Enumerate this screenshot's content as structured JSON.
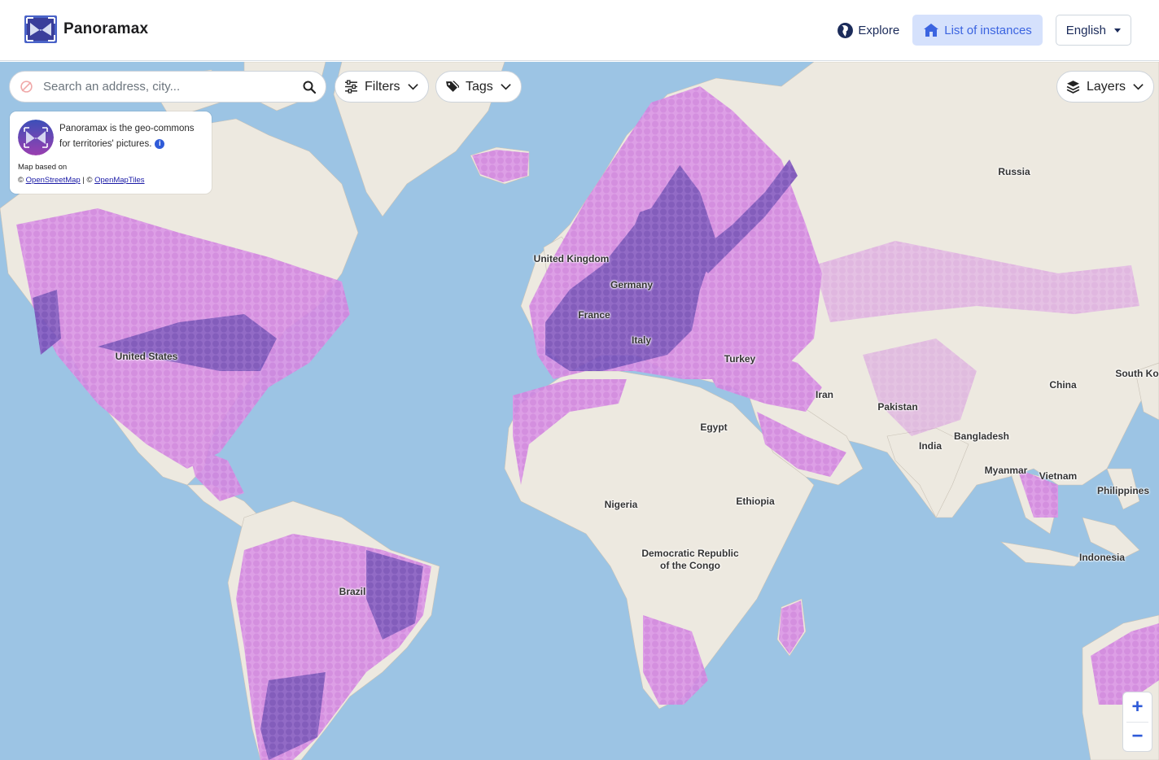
{
  "header": {
    "app_name": "Panoramax",
    "nav": {
      "explore_label": "Explore",
      "instances_label": "List of instances",
      "language_label": "English"
    }
  },
  "toolbar": {
    "search_placeholder": "Search an address, city...",
    "filters_label": "Filters",
    "tags_label": "Tags",
    "layers_label": "Layers"
  },
  "info_panel": {
    "tagline_line1": "Panoramax is the geo-commons",
    "tagline_line2": "for territories' pictures.",
    "info_glyph": "i",
    "map_based_on": "Map based on",
    "copyright_symbol": "©",
    "separator": "|",
    "osm_link": "OpenStreetMap",
    "omt_link": "OpenMapTiles"
  },
  "zoom": {
    "in_label": "+",
    "out_label": "−"
  },
  "map_labels": [
    {
      "id": "russia",
      "text": "Russia"
    },
    {
      "id": "united-kingdom",
      "text": "United Kingdom"
    },
    {
      "id": "germany",
      "text": "Germany"
    },
    {
      "id": "france",
      "text": "France"
    },
    {
      "id": "italy",
      "text": "Italy"
    },
    {
      "id": "turkey",
      "text": "Turkey"
    },
    {
      "id": "united-states",
      "text": "United States"
    },
    {
      "id": "china",
      "text": "China"
    },
    {
      "id": "south-ko",
      "text": "South Ko"
    },
    {
      "id": "iran",
      "text": "Iran"
    },
    {
      "id": "pakistan",
      "text": "Pakistan"
    },
    {
      "id": "egypt",
      "text": "Egypt"
    },
    {
      "id": "india",
      "text": "India"
    },
    {
      "id": "bangladesh",
      "text": "Bangladesh"
    },
    {
      "id": "myanmar",
      "text": "Myanmar"
    },
    {
      "id": "vietnam",
      "text": "Vietnam"
    },
    {
      "id": "philippines",
      "text": "Philippines"
    },
    {
      "id": "nigeria",
      "text": "Nigeria"
    },
    {
      "id": "ethiopia",
      "text": "Ethiopia"
    },
    {
      "id": "drc-line1",
      "text": "Democratic Republic"
    },
    {
      "id": "drc-line2",
      "text": "of the Congo"
    },
    {
      "id": "indonesia",
      "text": "Indonesia"
    },
    {
      "id": "brazil",
      "text": "Brazil"
    }
  ],
  "colors": {
    "accent": "#2f5bd8",
    "nav_active_bg": "#d5e1fc",
    "water": "#9cc4e4",
    "land": "#ede9e0",
    "coverage_light": "#d98fe0",
    "coverage_dark": "#6f4eb6"
  },
  "icons": {
    "explore": "globe-icon",
    "instances": "home-icon",
    "search_pin": "no-location-icon",
    "search": "search-icon",
    "filters": "sliders-icon",
    "tags": "tags-icon",
    "layers": "layers-icon"
  }
}
